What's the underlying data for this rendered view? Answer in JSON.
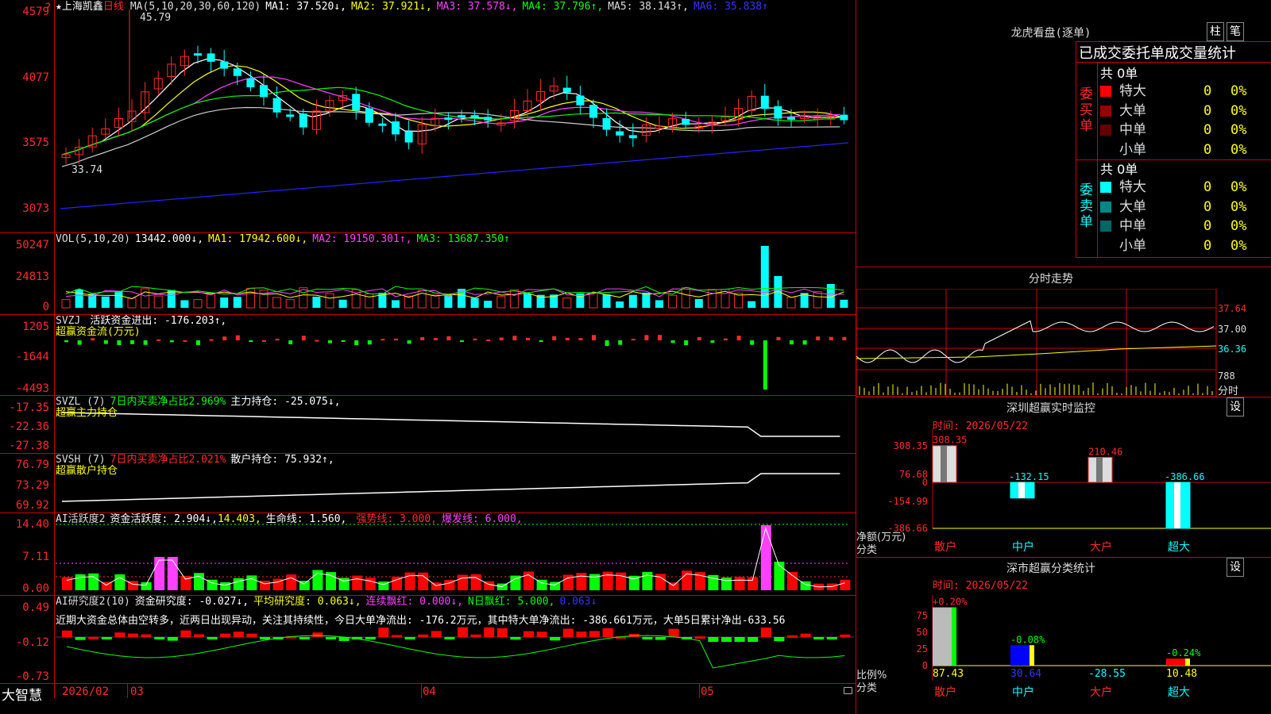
{
  "stock": {
    "title": "★上海凯鑫",
    "period": "日线",
    "ma_label": "MA(5,10,20,30,60,120)",
    "ma1": "MA1: 37.520↓,",
    "ma2": "MA2: 37.921↓,",
    "ma3": "MA3: 37.578↓,",
    "ma4": "MA4: 37.796↑,",
    "ma5": "MA5: 38.143↑,",
    "ma6": "MA6: 35.838↑",
    "y_labels": [
      "4579",
      "4077",
      "3575",
      "3073"
    ],
    "high_mark": "45.79",
    "low_mark": "33.74",
    "question": "?"
  },
  "vol": {
    "label": "VOL(5,10,20)",
    "value": "13442.000↓,",
    "ma1": "MA1: 17942.600↓,",
    "ma2": "MA2: 19150.301↑,",
    "ma3": "MA3: 13687.350↑",
    "y_labels": [
      "50247",
      "24813",
      "0"
    ]
  },
  "svzj": {
    "label": "SVZJ",
    "text": "活跃资金进出: -176.203↑,",
    "sub": "超赢资金流(万元)",
    "y_labels": [
      "1205",
      "-1644",
      "-4493"
    ]
  },
  "svzl": {
    "label": "SVZL (7)",
    "ratio": "7日内买卖净占比2.969%",
    "text": "主力持仓: -25.075↓,",
    "sub": "超赢主力持仓",
    "y_labels": [
      "-17.35",
      "-22.36",
      "-27.38"
    ]
  },
  "svsh": {
    "label": "SVSH (7)",
    "ratio": "7日内买卖净占比2.021%",
    "text": "散户持仓: 75.932↑,",
    "sub": "超赢散户持仓",
    "y_labels": [
      "76.79",
      "73.29",
      "69.92"
    ]
  },
  "ai": {
    "label": "AI活跃度2",
    "act": "资金活跃度: 2.904↓,",
    "val2": "14.403,",
    "life": "生命线: 1.560,",
    "strong": "强势线: 3.000,",
    "burst": "爆发线: 6.000,",
    "y_labels": [
      "14.40",
      "7.11",
      "0.00"
    ]
  },
  "ai2": {
    "label": "AI研究度2(10)",
    "research": "资金研究度: -0.027↓,",
    "avg": "平均研究度: 0.063↓,",
    "cont": "连续飘红: 0.000↓,",
    "nday": "N日飘红: 5.000,",
    "extra": "0.063↓",
    "news": "近期大资金总体由空转多，近两日出现异动，关注其持续性，今日大单净流出: -176.2万元，其中特大单净流出: -386.661万元，大单5日累计净出-633.56",
    "y_labels": [
      "0.49",
      "-0.12",
      "-0.73"
    ]
  },
  "footer": {
    "brand": "大智慧",
    "dates": [
      "2026/02",
      "03",
      "04",
      "05"
    ]
  },
  "right": {
    "lhkp_title": "龙虎看盘(逐单)",
    "btn_zhu": "柱",
    "btn_bi": "笔",
    "stats_header": "已成交委托单成交量统计",
    "buy_total": "共 0单",
    "sell_total": "共 0单",
    "buy_side": "委买单",
    "sell_side": "委卖单",
    "buy_rows": [
      {
        "name": "特大",
        "color": "#ff0000",
        "v": "0",
        "p": "0%"
      },
      {
        "name": "大单",
        "color": "#990000",
        "v": "0",
        "p": "0%"
      },
      {
        "name": "中单",
        "color": "#660000",
        "v": "0",
        "p": "0%"
      },
      {
        "name": "小单",
        "color": "",
        "v": "0",
        "p": "0%"
      }
    ],
    "sell_rows": [
      {
        "name": "特大",
        "color": "#00ffff",
        "v": "0",
        "p": "0%"
      },
      {
        "name": "大单",
        "color": "#008888",
        "v": "0",
        "p": "0%"
      },
      {
        "name": "中单",
        "color": "#006666",
        "v": "0",
        "p": "0%"
      },
      {
        "name": "小单",
        "color": "",
        "v": "0",
        "p": "0%"
      }
    ],
    "fenshi_title": "分时走势",
    "fenshi_y": [
      "37.64",
      "37.00",
      "36.36"
    ],
    "fenshi_vol": "788",
    "fenshi_unit": "分时",
    "monitor_title": "深圳超赢实时监控",
    "monitor_btn": "设",
    "monitor_time": "时间: 2026/05/22",
    "monitor_y": [
      "308.35",
      "76.68",
      "0",
      "-154.99",
      "-386.66"
    ],
    "monitor_ylabel": "净额(万元)",
    "monitor_xlabel": "分类",
    "monitor_bars": [
      {
        "cat": "散户",
        "value": 308.35,
        "label": "308.35"
      },
      {
        "cat": "中户",
        "value": -132.15,
        "label": "-132.15"
      },
      {
        "cat": "大户",
        "value": 210.46,
        "label": "210.46"
      },
      {
        "cat": "超大",
        "value": -386.66,
        "label": "-386.66"
      }
    ],
    "class_title": "深市超赢分类统计",
    "class_btn": "设",
    "class_time": "时间: 2026/05/22",
    "class_y": [
      "75",
      "50",
      "25",
      "0"
    ],
    "class_ylabel": "比例%",
    "class_xlabel": "分类",
    "class_bars": [
      {
        "cat": "散户",
        "top": "+0.20%",
        "value": 87.43,
        "label": "87.43",
        "color": "#bbbbbb"
      },
      {
        "cat": "中户",
        "top": "-0.08%",
        "value": 30.64,
        "label": "30.64",
        "color": "#0000ff"
      },
      {
        "cat": "大户",
        "top": "",
        "value": -28.55,
        "label": "-28.55",
        "color": "#00ffff"
      },
      {
        "cat": "超大",
        "top": "-0.24%",
        "value": 10.48,
        "label": "10.48",
        "color": "#ff0000"
      }
    ]
  }
}
